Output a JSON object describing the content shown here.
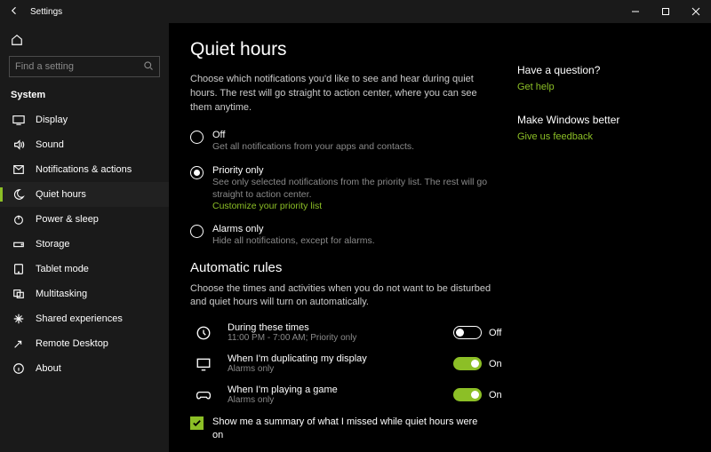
{
  "window": {
    "title": "Settings"
  },
  "search": {
    "placeholder": "Find a setting"
  },
  "sidebar": {
    "heading": "System",
    "items": [
      {
        "label": "Display"
      },
      {
        "label": "Sound"
      },
      {
        "label": "Notifications & actions"
      },
      {
        "label": "Quiet hours"
      },
      {
        "label": "Power & sleep"
      },
      {
        "label": "Storage"
      },
      {
        "label": "Tablet mode"
      },
      {
        "label": "Multitasking"
      },
      {
        "label": "Shared experiences"
      },
      {
        "label": "Remote Desktop"
      },
      {
        "label": "About"
      }
    ]
  },
  "main": {
    "title": "Quiet hours",
    "desc": "Choose which notifications you'd like to see and hear during quiet hours. The rest will go straight to action center, where you can see them anytime.",
    "options": {
      "off": {
        "title": "Off",
        "sub": "Get all notifications from your apps and contacts."
      },
      "priority": {
        "title": "Priority only",
        "sub": "See only selected notifications from the priority list. The rest will go straight to action center.",
        "link": "Customize your priority list"
      },
      "alarms": {
        "title": "Alarms only",
        "sub": "Hide all notifications, except for alarms."
      }
    },
    "rules_heading": "Automatic rules",
    "rules_desc": "Choose the times and activities when you do not want to be disturbed and quiet hours will turn on automatically.",
    "rules": [
      {
        "title": "During these times",
        "sub": "11:00 PM - 7:00 AM; Priority only",
        "state": "Off",
        "on": false
      },
      {
        "title": "When I'm duplicating my display",
        "sub": "Alarms only",
        "state": "On",
        "on": true
      },
      {
        "title": "When I'm playing a game",
        "sub": "Alarms only",
        "state": "On",
        "on": true
      }
    ],
    "summary_check": "Show me a summary of what I missed while quiet hours were on"
  },
  "aside": {
    "q_heading": "Have a question?",
    "q_link": "Get help",
    "fb_heading": "Make Windows better",
    "fb_link": "Give us feedback"
  }
}
